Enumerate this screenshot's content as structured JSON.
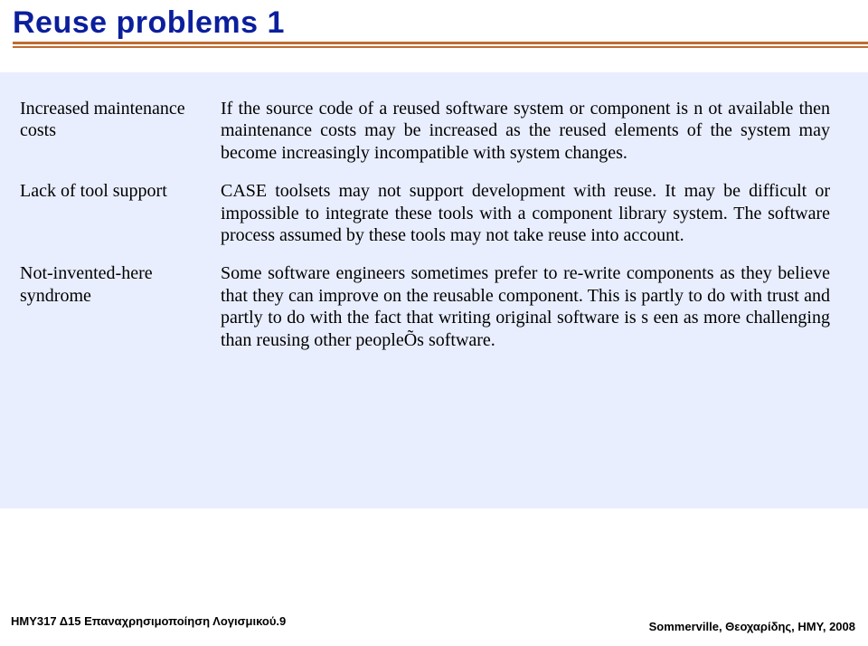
{
  "title": "Reuse problems 1",
  "rows": [
    {
      "label": "Increased maintenance costs",
      "text": "If the source code of a reused software system or component is n ot available then maintenance costs may be increased as the reused elements of the system may become increasingly incompatible with system changes."
    },
    {
      "label": "Lack of tool support",
      "text": "CASE toolsets may not support development with reuse. It may be difficult or impossible to integrate these tools with a component library system. The software process assumed by these tools may not take reuse into account."
    },
    {
      "label": "Not-invented-here syndrome",
      "text": "Some software engineers sometimes prefer to re-write components as they believe that they can improve on the reusable component. This is partly to do with trust and partly to do with the fact that writing original software is s een as more challenging than reusing other peopleÕs software."
    }
  ],
  "footer_left": "ΗΜΥ317 Δ15 Επαναχρησιμοποίηση Λογισμικού.9",
  "footer_right": "Sommerville, Θεοχαρίδης, ΗΜΥ, 2008"
}
